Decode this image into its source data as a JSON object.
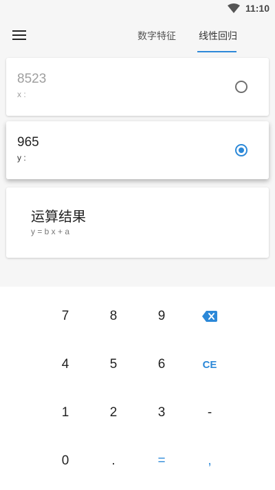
{
  "status_bar": {
    "time": "11:10",
    "wifi_icon": "wifi-icon"
  },
  "header": {
    "menu_icon": "hamburger-menu-icon",
    "tabs": [
      {
        "label": "数字特征",
        "selected": false
      },
      {
        "label": "线性回归",
        "selected": true
      }
    ]
  },
  "inputs": {
    "x": {
      "value": "8523",
      "label": "x :",
      "selected": false
    },
    "y": {
      "value": "965",
      "label": "y :",
      "selected": true
    }
  },
  "result": {
    "title": "运算结果",
    "formula": "y = b x + a"
  },
  "keypad": {
    "row1": [
      "7",
      "8",
      "9"
    ],
    "backspace_icon": "backspace-icon",
    "row2": [
      "4",
      "5",
      "6",
      "CE"
    ],
    "row3": [
      "1",
      "2",
      "3",
      "-"
    ],
    "row4": [
      "0",
      ".",
      "=",
      ","
    ]
  },
  "colors": {
    "accent": "#2b88d8",
    "background": "#f6f6f6"
  }
}
